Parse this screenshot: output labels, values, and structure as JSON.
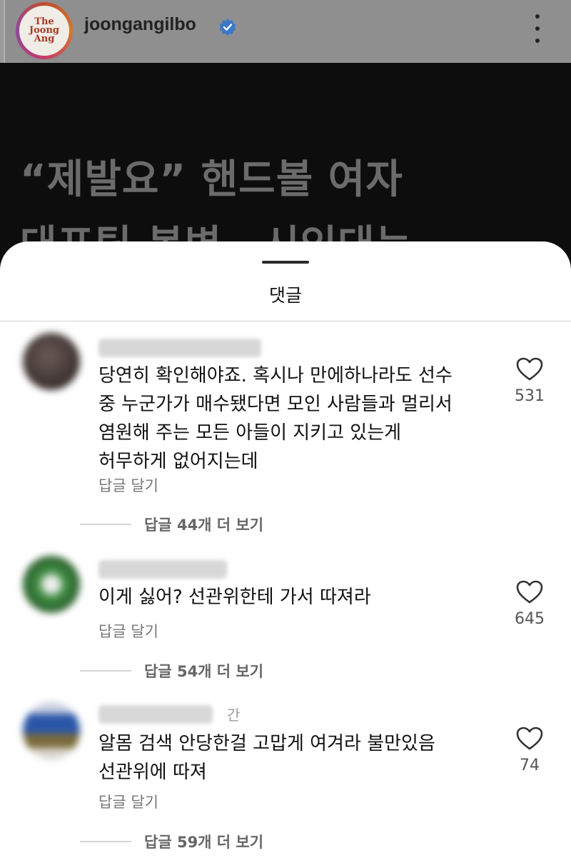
{
  "header": {
    "logo_text": "The\nJoong\nAng",
    "account_name": "joongangilbo",
    "verified_icon": "verified-badge-icon",
    "more_icon": "more-vertical-icon"
  },
  "post": {
    "headline": "“제발요” 핸드볼 여자\n대표팀 봉변…시인대는"
  },
  "sheet": {
    "title": "댓글"
  },
  "comments": [
    {
      "time": "",
      "text": "당연히 확인해야죠. 혹시나 만에하나라도 선수\n중 누군가가 매수됐다면 모인 사람들과 멀리서\n염원해 주는 모든 아들이 지키고 있는게\n허무하게 없어지는데",
      "reply_label": "답글 달기",
      "likes": "531",
      "more_replies": "답글 44개 더 보기"
    },
    {
      "time": "",
      "text": "이게 싫어? 선관위한테 가서 따져라",
      "reply_label": "답글 달기",
      "likes": "645",
      "more_replies": "답글 54개 더 보기"
    },
    {
      "time": "간",
      "text": "알몸 검색 안당한걸 고맙게 여겨라 불만있음\n선관위에 따져",
      "reply_label": "답글 달기",
      "likes": "74",
      "more_replies": "답글 59개 더 보기"
    }
  ],
  "colors": {
    "dim_header": "#8f8f8f",
    "post_bg": "#0d0d0d",
    "verified_blue": "#3a79c6"
  }
}
